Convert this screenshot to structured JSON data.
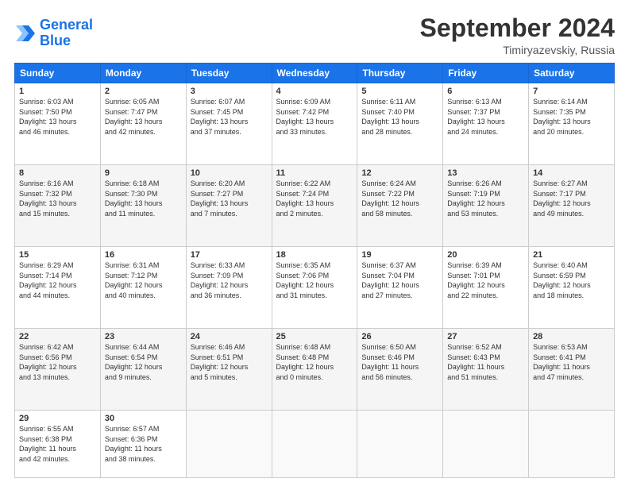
{
  "header": {
    "logo_line1": "General",
    "logo_line2": "Blue",
    "month": "September 2024",
    "location": "Timiryazevskiy, Russia"
  },
  "days_of_week": [
    "Sunday",
    "Monday",
    "Tuesday",
    "Wednesday",
    "Thursday",
    "Friday",
    "Saturday"
  ],
  "weeks": [
    [
      {
        "day": "1",
        "info": "Sunrise: 6:03 AM\nSunset: 7:50 PM\nDaylight: 13 hours\nand 46 minutes."
      },
      {
        "day": "2",
        "info": "Sunrise: 6:05 AM\nSunset: 7:47 PM\nDaylight: 13 hours\nand 42 minutes."
      },
      {
        "day": "3",
        "info": "Sunrise: 6:07 AM\nSunset: 7:45 PM\nDaylight: 13 hours\nand 37 minutes."
      },
      {
        "day": "4",
        "info": "Sunrise: 6:09 AM\nSunset: 7:42 PM\nDaylight: 13 hours\nand 33 minutes."
      },
      {
        "day": "5",
        "info": "Sunrise: 6:11 AM\nSunset: 7:40 PM\nDaylight: 13 hours\nand 28 minutes."
      },
      {
        "day": "6",
        "info": "Sunrise: 6:13 AM\nSunset: 7:37 PM\nDaylight: 13 hours\nand 24 minutes."
      },
      {
        "day": "7",
        "info": "Sunrise: 6:14 AM\nSunset: 7:35 PM\nDaylight: 13 hours\nand 20 minutes."
      }
    ],
    [
      {
        "day": "8",
        "info": "Sunrise: 6:16 AM\nSunset: 7:32 PM\nDaylight: 13 hours\nand 15 minutes."
      },
      {
        "day": "9",
        "info": "Sunrise: 6:18 AM\nSunset: 7:30 PM\nDaylight: 13 hours\nand 11 minutes."
      },
      {
        "day": "10",
        "info": "Sunrise: 6:20 AM\nSunset: 7:27 PM\nDaylight: 13 hours\nand 7 minutes."
      },
      {
        "day": "11",
        "info": "Sunrise: 6:22 AM\nSunset: 7:24 PM\nDaylight: 13 hours\nand 2 minutes."
      },
      {
        "day": "12",
        "info": "Sunrise: 6:24 AM\nSunset: 7:22 PM\nDaylight: 12 hours\nand 58 minutes."
      },
      {
        "day": "13",
        "info": "Sunrise: 6:26 AM\nSunset: 7:19 PM\nDaylight: 12 hours\nand 53 minutes."
      },
      {
        "day": "14",
        "info": "Sunrise: 6:27 AM\nSunset: 7:17 PM\nDaylight: 12 hours\nand 49 minutes."
      }
    ],
    [
      {
        "day": "15",
        "info": "Sunrise: 6:29 AM\nSunset: 7:14 PM\nDaylight: 12 hours\nand 44 minutes."
      },
      {
        "day": "16",
        "info": "Sunrise: 6:31 AM\nSunset: 7:12 PM\nDaylight: 12 hours\nand 40 minutes."
      },
      {
        "day": "17",
        "info": "Sunrise: 6:33 AM\nSunset: 7:09 PM\nDaylight: 12 hours\nand 36 minutes."
      },
      {
        "day": "18",
        "info": "Sunrise: 6:35 AM\nSunset: 7:06 PM\nDaylight: 12 hours\nand 31 minutes."
      },
      {
        "day": "19",
        "info": "Sunrise: 6:37 AM\nSunset: 7:04 PM\nDaylight: 12 hours\nand 27 minutes."
      },
      {
        "day": "20",
        "info": "Sunrise: 6:39 AM\nSunset: 7:01 PM\nDaylight: 12 hours\nand 22 minutes."
      },
      {
        "day": "21",
        "info": "Sunrise: 6:40 AM\nSunset: 6:59 PM\nDaylight: 12 hours\nand 18 minutes."
      }
    ],
    [
      {
        "day": "22",
        "info": "Sunrise: 6:42 AM\nSunset: 6:56 PM\nDaylight: 12 hours\nand 13 minutes."
      },
      {
        "day": "23",
        "info": "Sunrise: 6:44 AM\nSunset: 6:54 PM\nDaylight: 12 hours\nand 9 minutes."
      },
      {
        "day": "24",
        "info": "Sunrise: 6:46 AM\nSunset: 6:51 PM\nDaylight: 12 hours\nand 5 minutes."
      },
      {
        "day": "25",
        "info": "Sunrise: 6:48 AM\nSunset: 6:48 PM\nDaylight: 12 hours\nand 0 minutes."
      },
      {
        "day": "26",
        "info": "Sunrise: 6:50 AM\nSunset: 6:46 PM\nDaylight: 11 hours\nand 56 minutes."
      },
      {
        "day": "27",
        "info": "Sunrise: 6:52 AM\nSunset: 6:43 PM\nDaylight: 11 hours\nand 51 minutes."
      },
      {
        "day": "28",
        "info": "Sunrise: 6:53 AM\nSunset: 6:41 PM\nDaylight: 11 hours\nand 47 minutes."
      }
    ],
    [
      {
        "day": "29",
        "info": "Sunrise: 6:55 AM\nSunset: 6:38 PM\nDaylight: 11 hours\nand 42 minutes."
      },
      {
        "day": "30",
        "info": "Sunrise: 6:57 AM\nSunset: 6:36 PM\nDaylight: 11 hours\nand 38 minutes."
      },
      {
        "day": "",
        "info": ""
      },
      {
        "day": "",
        "info": ""
      },
      {
        "day": "",
        "info": ""
      },
      {
        "day": "",
        "info": ""
      },
      {
        "day": "",
        "info": ""
      }
    ]
  ]
}
